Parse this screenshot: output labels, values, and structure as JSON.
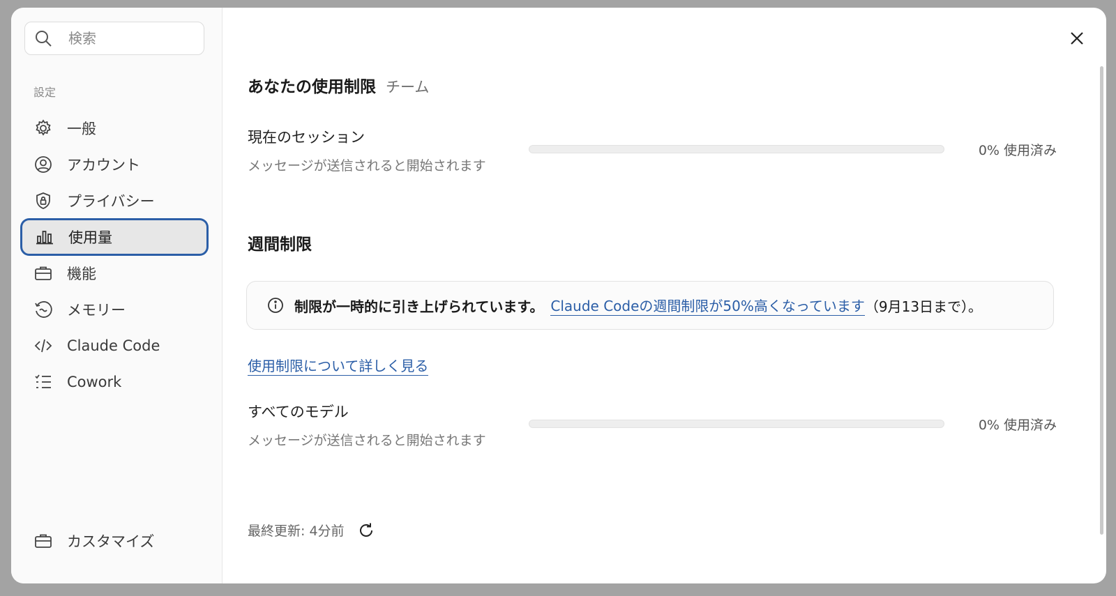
{
  "search": {
    "placeholder": "検索"
  },
  "sidebar": {
    "section_label": "設定",
    "items": [
      {
        "label": "一般",
        "icon": "gear-icon"
      },
      {
        "label": "アカウント",
        "icon": "account-icon"
      },
      {
        "label": "プライバシー",
        "icon": "shield-lock-icon"
      },
      {
        "label": "使用量",
        "icon": "bar-chart-icon",
        "active": true
      },
      {
        "label": "機能",
        "icon": "briefcase-icon"
      },
      {
        "label": "メモリー",
        "icon": "memory-icon"
      },
      {
        "label": "Claude Code",
        "icon": "code-icon"
      },
      {
        "label": "Cowork",
        "icon": "checklist-icon"
      }
    ],
    "bottom_item": {
      "label": "カスタマイズ",
      "icon": "briefcase-icon"
    }
  },
  "main": {
    "title": "あなたの使用制限",
    "subtitle": "チーム",
    "current_session": {
      "name": "現在のセッション",
      "desc": "メッセージが送信されると開始されます",
      "usage_text": "0% 使用済み",
      "usage_fraction": 0
    },
    "weekly": {
      "title": "週間制限",
      "notice_strong": "制限が一時的に引き上げられています。",
      "notice_link": "Claude Codeの週間制限が50%高くなっています",
      "notice_tail": "（9月13日まで）。",
      "learn_more": "使用制限について詳しく見る",
      "all_models": {
        "name": "すべてのモデル",
        "desc": "メッセージが送信されると開始されます",
        "usage_text": "0% 使用済み",
        "usage_fraction": 0
      }
    },
    "last_updated": "最終更新: 4分前"
  },
  "colors": {
    "accent": "#2b5ea7",
    "active_bg": "#e7e7e7"
  }
}
